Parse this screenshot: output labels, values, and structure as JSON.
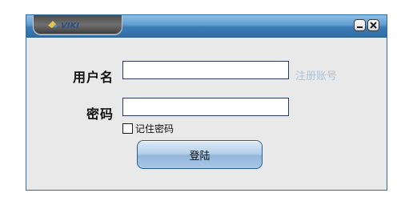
{
  "window": {
    "logo_text": "VIKI",
    "controls": [
      "minimize-icon",
      "close-icon"
    ]
  },
  "form": {
    "username_label": "用户名",
    "username_value": "",
    "password_label": "密码",
    "password_value": "",
    "register_link": "注册账号",
    "remember_label": "记住密码",
    "remember_checked": false,
    "login_button": "登陆"
  },
  "colors": {
    "titlebar": "#3d7db5",
    "window_bg": "#e9e9e9",
    "link": "#a9c4df",
    "button": "#a9c7e6"
  }
}
